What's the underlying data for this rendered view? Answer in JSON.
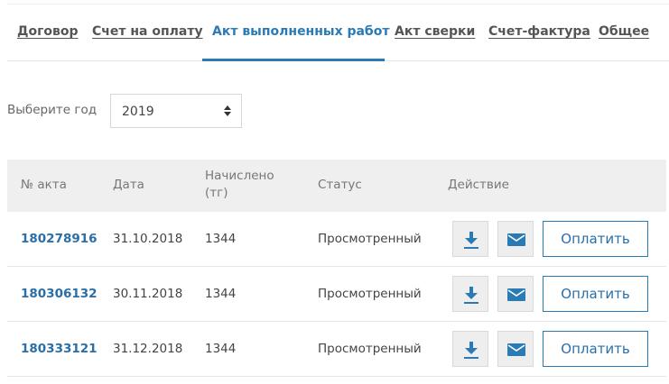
{
  "tabs": [
    {
      "label": "Договор"
    },
    {
      "label": "Счет на оплату"
    },
    {
      "label": "Акт выполненных работ"
    },
    {
      "label": "Акт сверки"
    },
    {
      "label": "Счет-фактура"
    },
    {
      "label": "Общее"
    }
  ],
  "active_tab": "Акт выполненных работ",
  "year_filter": {
    "label": "Выберите год",
    "value": "2019"
  },
  "table": {
    "headers": {
      "number": "№ акта",
      "date": "Дата",
      "charged": "Начислено (тг)",
      "status": "Статус",
      "action": "Действие"
    },
    "rows": [
      {
        "number": "180278916",
        "date": "31.10.2018",
        "amount": "1344",
        "status": "Просмотренный",
        "pay_label": "Оплатить"
      },
      {
        "number": "180306132",
        "date": "30.11.2018",
        "amount": "1344",
        "status": "Просмотренный",
        "pay_label": "Оплатить"
      },
      {
        "number": "180333121",
        "date": "31.12.2018",
        "amount": "1344",
        "status": "Просмотренный",
        "pay_label": "Оплатить"
      }
    ]
  },
  "icons": {
    "download": "download-icon",
    "email": "envelope-icon"
  },
  "colors": {
    "accent": "#2a7bb5",
    "link": "#2a6fa8",
    "header_bg": "#efefef"
  }
}
